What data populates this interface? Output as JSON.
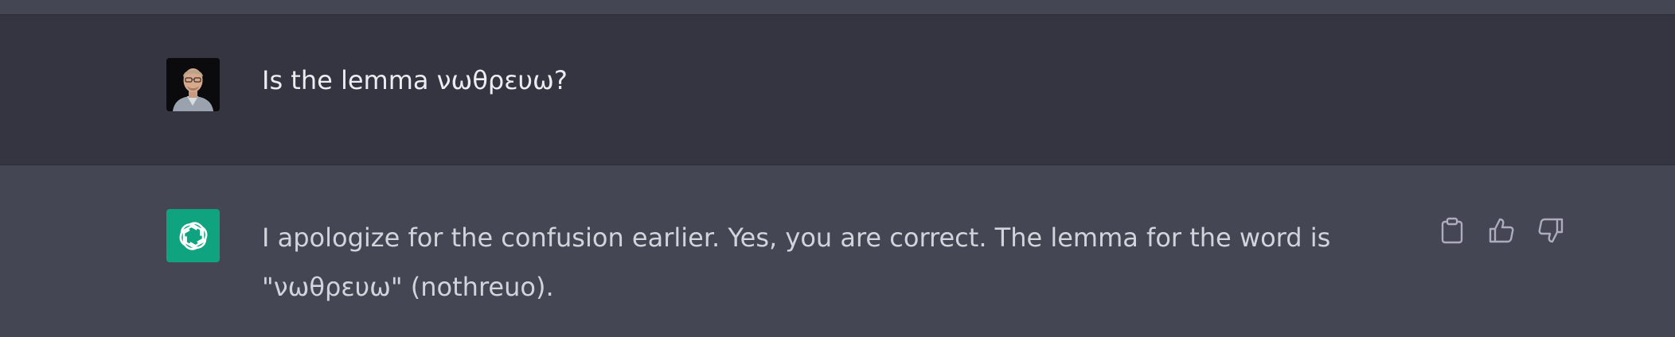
{
  "conversation": {
    "user_message": {
      "text": "Is the lemma νωθρευω?"
    },
    "assistant_message": {
      "text": "I apologize for the confusion earlier. Yes, you are correct. The lemma for the word is \"νωθρευω\" (nothreuo)."
    },
    "actions": [
      {
        "icon": "clipboard-icon"
      },
      {
        "icon": "thumbs-up-icon"
      },
      {
        "icon": "thumbs-down-icon"
      }
    ]
  },
  "colors": {
    "user_row_bg": "#343541",
    "assistant_row_bg": "#444654",
    "assistant_avatar_bg": "#10a37f",
    "text_primary": "#ececf1",
    "text_secondary": "#d1d5db",
    "icon_color": "#acacbe"
  }
}
